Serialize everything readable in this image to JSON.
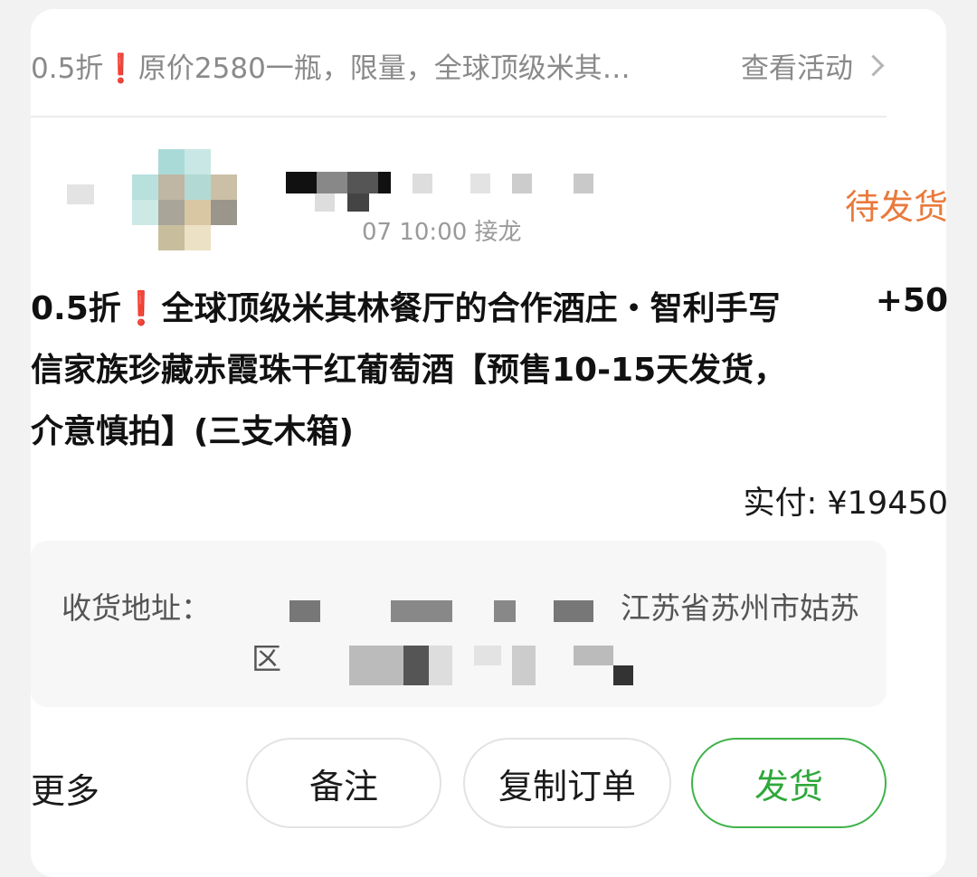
{
  "activity": {
    "text": "0.5折❗原价2580一瓶，限量，全球顶级米其…",
    "link_label": "查看活动",
    "chevron_icon": "chevron-right-icon"
  },
  "order": {
    "time": "07 10:00 接龙",
    "status": "待发货",
    "status_color": "#e97a3c"
  },
  "product": {
    "title": "0.5折❗全球顶级米其林餐厅的合作酒庄・智利手写信家族珍藏赤霞珠干红葡萄酒【预售10-15天发货，介意慎拍】(三支木箱)",
    "quantity": "+50",
    "paid_label": "实付:",
    "paid_amount": "¥19450"
  },
  "address": {
    "label": "收货地址：",
    "line1": "江苏省苏州市姑苏",
    "line2": "区"
  },
  "actions": {
    "more": "更多",
    "note": "备注",
    "copy": "复制订单",
    "ship": "发货",
    "ship_color": "#2ea83a"
  }
}
